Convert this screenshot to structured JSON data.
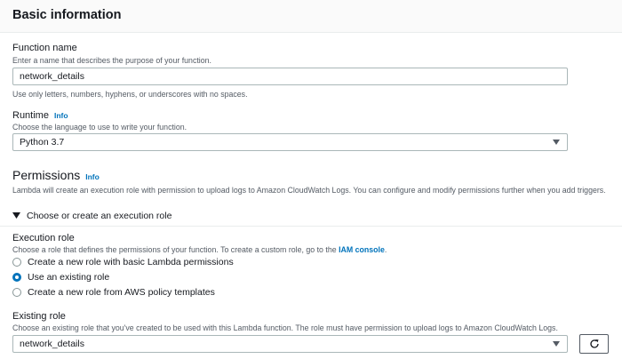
{
  "header": {
    "title": "Basic information"
  },
  "function_name": {
    "label": "Function name",
    "description": "Enter a name that describes the purpose of your function.",
    "value": "network_details",
    "hint": "Use only letters, numbers, hyphens, or underscores with no spaces."
  },
  "runtime": {
    "label": "Runtime",
    "info": "Info",
    "description": "Choose the language to use to write your function.",
    "selected": "Python 3.7"
  },
  "permissions": {
    "title": "Permissions",
    "info": "Info",
    "description": "Lambda will create an execution role with permission to upload logs to Amazon CloudWatch Logs. You can configure and modify permissions further when you add triggers.",
    "expander_label": "Choose or create an execution role"
  },
  "execution_role": {
    "label": "Execution role",
    "description_prefix": "Choose a role that defines the permissions of your function. To create a custom role, go to the",
    "link": "IAM console",
    "description_suffix": ".",
    "options": [
      {
        "label": "Create a new role with basic Lambda permissions",
        "checked": false
      },
      {
        "label": "Use an existing role",
        "checked": true
      },
      {
        "label": "Create a new role from AWS policy templates",
        "checked": false
      }
    ]
  },
  "existing_role": {
    "label": "Existing role",
    "description": "Choose an existing role that you've created to be used with this Lambda function. The role must have permission to upload logs to Amazon CloudWatch Logs.",
    "selected": "network_details"
  },
  "colors": {
    "accent": "#0073bb",
    "text": "#16191f",
    "muted": "#545b64",
    "border": "#aab7b8"
  },
  "icons": {
    "caret": "caret-down-icon",
    "refresh": "refresh-icon",
    "expander": "triangle-down-icon"
  }
}
